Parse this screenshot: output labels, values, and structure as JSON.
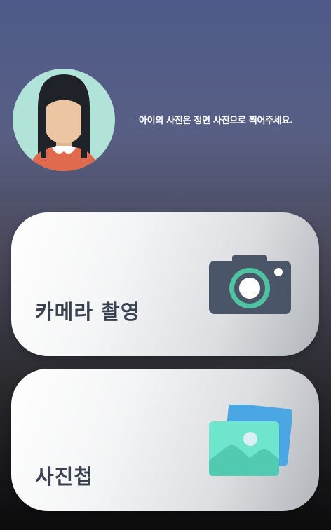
{
  "header": {
    "avatar_icon": "girl-avatar-icon",
    "hint_text": "아이의 사진은 정면 사진으로 찍어주세요."
  },
  "actions": {
    "camera": {
      "label": "카메라  촬영",
      "icon": "camera-icon"
    },
    "album": {
      "label": "사진첩",
      "icon": "photo-album-icon"
    }
  },
  "colors": {
    "avatar_bg": "#b2e3d9",
    "hair": "#1f2228",
    "skin": "#ecc6a2",
    "shirt": "#e06b4c",
    "camera_body": "#4a5568",
    "camera_ring": "#4fc3a1",
    "album_back": "#4aa7e4",
    "album_front": "#6ee5cc",
    "label_text": "#3a4251"
  }
}
